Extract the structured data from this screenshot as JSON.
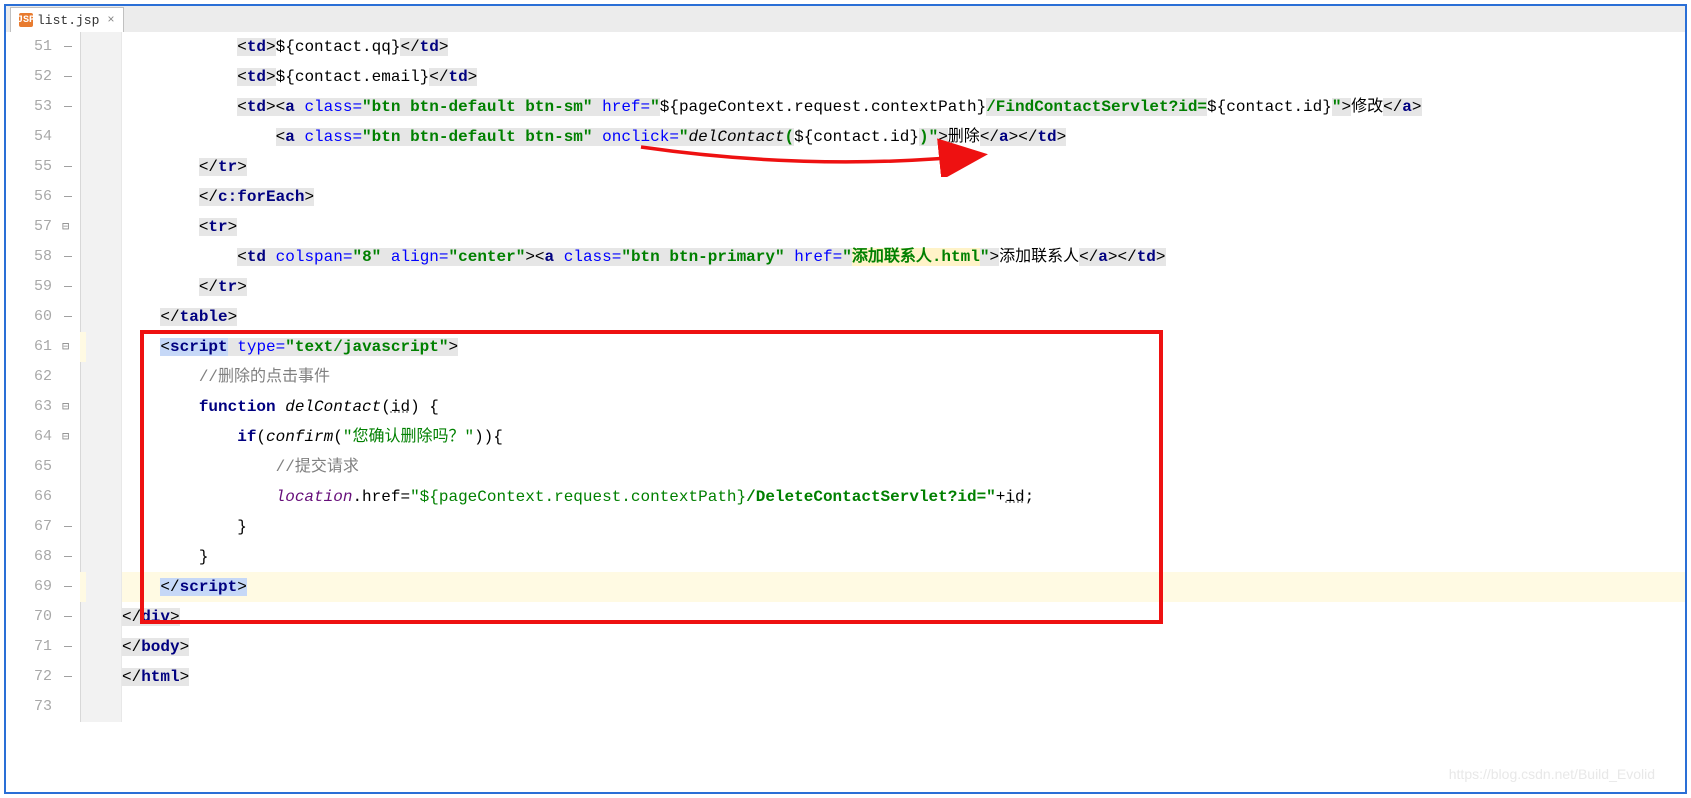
{
  "tab": {
    "icon": "JSP",
    "name": "list.jsp",
    "close": "×"
  },
  "lines": [
    {
      "n": 51,
      "fold": "end"
    },
    {
      "n": 52,
      "fold": "end"
    },
    {
      "n": 53,
      "fold": "end"
    },
    {
      "n": 54,
      "fold": ""
    },
    {
      "n": 55,
      "fold": "end"
    },
    {
      "n": 56,
      "fold": "end"
    },
    {
      "n": 57,
      "fold": "minus"
    },
    {
      "n": 58,
      "fold": "end"
    },
    {
      "n": 59,
      "fold": "end"
    },
    {
      "n": 60,
      "fold": "end"
    },
    {
      "n": 61,
      "fold": "minus"
    },
    {
      "n": 62,
      "fold": ""
    },
    {
      "n": 63,
      "fold": "minus"
    },
    {
      "n": 64,
      "fold": "minus"
    },
    {
      "n": 65,
      "fold": ""
    },
    {
      "n": 66,
      "fold": ""
    },
    {
      "n": 67,
      "fold": "end"
    },
    {
      "n": 68,
      "fold": "end"
    },
    {
      "n": 69,
      "fold": "end",
      "caret": true
    },
    {
      "n": 70,
      "fold": "end"
    },
    {
      "n": 71,
      "fold": "end"
    },
    {
      "n": 72,
      "fold": "end"
    },
    {
      "n": 73,
      "fold": ""
    }
  ],
  "code": {
    "l51": {
      "indent": "            ",
      "expr": "${contact.qq}"
    },
    "l52": {
      "indent": "            ",
      "expr": "${contact.email}"
    },
    "l53": {
      "indent": "            ",
      "cls": "btn btn-default btn-sm",
      "href_pre": "${pageContext.request.contextPath}",
      "href_mid": "/FindContactServlet?id=",
      "href_post": "${contact.id}",
      "label": "修改"
    },
    "l54": {
      "indent": "                ",
      "cls": "btn btn-default btn-sm",
      "onclick_fn": "delContact",
      "onclick_arg": "${contact.id}",
      "label": "删除"
    },
    "l55": {
      "indent": "        ",
      "close": "tr"
    },
    "l56": {
      "indent": "        ",
      "close": "c:forEach"
    },
    "l57": {
      "indent": "        ",
      "open": "tr"
    },
    "l58": {
      "indent": "            ",
      "colspan": "8",
      "align": "center",
      "cls": "btn btn-primary",
      "href": "添加联系人.html",
      "label": "添加联系人"
    },
    "l59": {
      "indent": "        ",
      "close": "tr"
    },
    "l60": {
      "indent": "    ",
      "close": "table"
    },
    "l61": {
      "indent": "    ",
      "type": "text/javascript"
    },
    "l62": {
      "indent": "        ",
      "comment": "//删除的点击事件"
    },
    "l63": {
      "indent": "        ",
      "kw": "function",
      "fn": "delContact",
      "param": "id"
    },
    "l64": {
      "indent": "            ",
      "kw": "if",
      "call": "confirm",
      "arg": "\"您确认删除吗？\""
    },
    "l65": {
      "indent": "                ",
      "comment": "//提交请求"
    },
    "l66": {
      "indent": "                ",
      "obj": "location",
      "prop": "href",
      "str_pre": "\"${pageContext.request.contextPath}",
      "str_mid": "/DeleteContactServlet?id=\"",
      "plus": "+",
      "var": "id"
    },
    "l67": {
      "indent": "            ",
      "brace": "}"
    },
    "l68": {
      "indent": "        ",
      "brace": "}"
    },
    "l69": {
      "indent": "    ",
      "close": "script"
    },
    "l70": {
      "close": "div"
    },
    "l71": {
      "close": "body"
    },
    "l72": {
      "close": "html"
    }
  },
  "watermark": "https://blog.csdn.net/Build_Evolid"
}
